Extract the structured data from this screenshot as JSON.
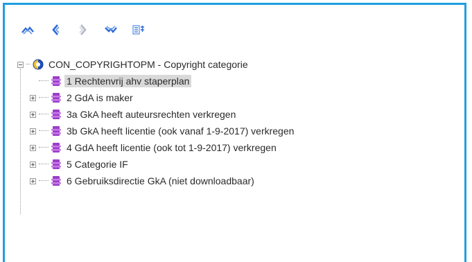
{
  "toolbar": {
    "buttons": [
      {
        "icon": "collapse-all-icon",
        "color": "#2f6bd8"
      },
      {
        "icon": "back-icon",
        "color": "#2f6bd8"
      },
      {
        "icon": "forward-icon",
        "color": "#b0b8c8"
      },
      {
        "icon": "expand-all-icon",
        "color": "#2f6bd8"
      },
      {
        "icon": "options-icon",
        "color": "#2f6bd8"
      }
    ]
  },
  "tree": {
    "root": {
      "label": "CON_COPYRIGHTOPM - Copyright categorie",
      "icon": "form-icon"
    },
    "items": [
      {
        "label": "1 Rechtenvrij ahv staperplan",
        "selected": true,
        "expandable": false
      },
      {
        "label": "2 GdA is maker",
        "selected": false,
        "expandable": true
      },
      {
        "label": "3a GkA heeft auteursrechten verkregen",
        "selected": false,
        "expandable": true
      },
      {
        "label": "3b GkA heeft licentie (ook vanaf 1-9-2017) verkregen",
        "selected": false,
        "expandable": true
      },
      {
        "label": "4 GdA heeft licentie (ook tot 1-9-2017) verkregen",
        "selected": false,
        "expandable": true
      },
      {
        "label": "5 Categorie IF",
        "selected": false,
        "expandable": true
      },
      {
        "label": "6 Gebruiksdirectie GkA (niet downloadbaar)",
        "selected": false,
        "expandable": true
      }
    ]
  },
  "colors": {
    "frame": "#1e9fe0",
    "node_icon": "#9b3ec9",
    "selected_bg": "#d9d9d9"
  }
}
